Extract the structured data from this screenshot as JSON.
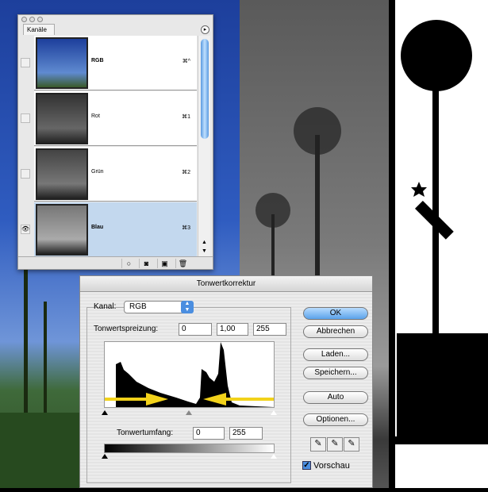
{
  "channels_panel": {
    "tab": "Kanäle",
    "rows": [
      {
        "name": "RGB",
        "shortcut": "⌘^",
        "visible": false,
        "selected": false
      },
      {
        "name": "Rot",
        "shortcut": "⌘1",
        "visible": false,
        "selected": false
      },
      {
        "name": "Grün",
        "shortcut": "⌘2",
        "visible": false,
        "selected": false
      },
      {
        "name": "Blau",
        "shortcut": "⌘3",
        "visible": true,
        "selected": true
      }
    ]
  },
  "levels_dialog": {
    "title": "Tonwertkorrektur",
    "channel_label": "Kanal:",
    "channel_value": "RGB",
    "input_levels_label": "Tonwertspreizung:",
    "input_black": "0",
    "input_gamma": "1,00",
    "input_white": "255",
    "output_levels_label": "Tonwertumfang:",
    "output_black": "0",
    "output_white": "255",
    "buttons": {
      "ok": "OK",
      "cancel": "Abbrechen",
      "load": "Laden...",
      "save": "Speichern...",
      "auto": "Auto",
      "options": "Optionen..."
    },
    "preview_label": "Vorschau",
    "preview_checked": true
  },
  "colors": {
    "accent": "#4b8ee0",
    "arrow": "#f2d21a",
    "selection": "#c3d8ee"
  }
}
